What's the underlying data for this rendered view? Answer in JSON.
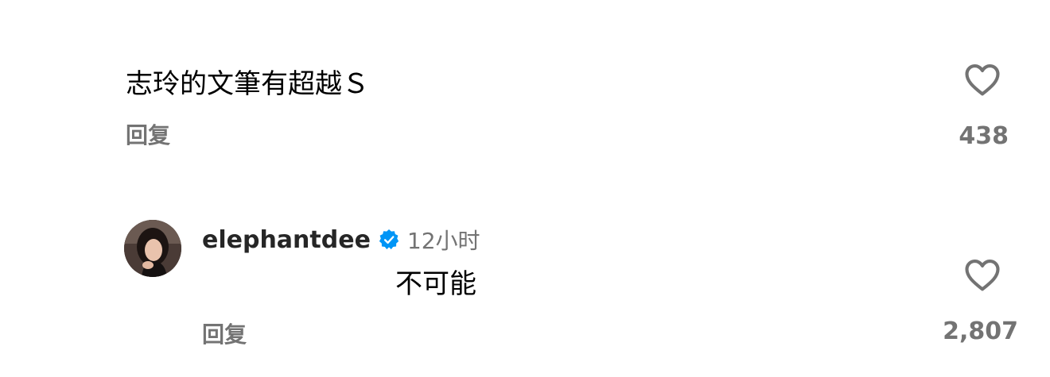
{
  "comment": {
    "text": "志玲的文筆有超越Ｓ",
    "reply_label": "回复",
    "like_count": "438",
    "like_icon": "heart-outline-icon"
  },
  "reply": {
    "username": "elephantdee",
    "verified_icon": "verified-badge-icon",
    "verified_color": "#0095f6",
    "timestamp": "12小时",
    "text": "不可能",
    "reply_label": "回复",
    "like_count": "2,807",
    "like_icon": "heart-outline-icon"
  },
  "colors": {
    "text_primary": "#000000",
    "text_secondary": "#737373",
    "icon": "#737373"
  }
}
